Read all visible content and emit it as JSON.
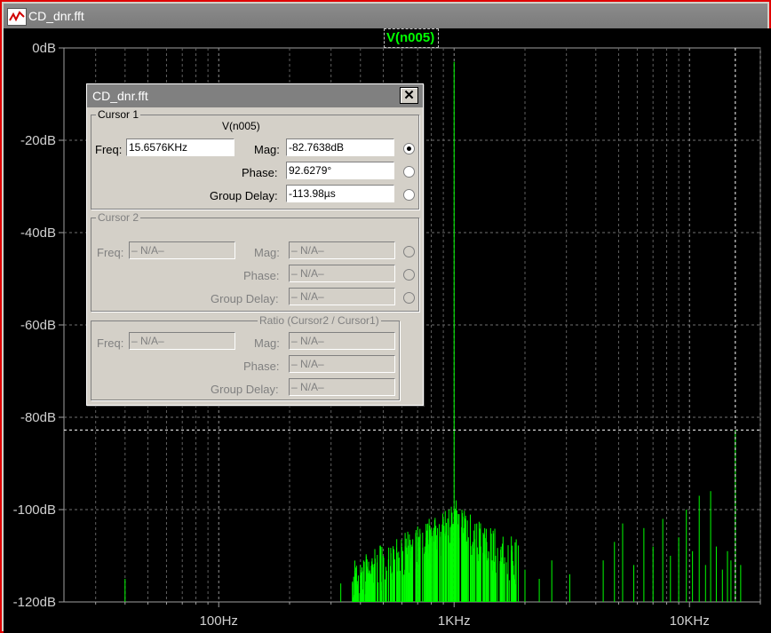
{
  "window": {
    "title": "CD_dnr.fft"
  },
  "trace": {
    "name": "V(n005)",
    "color": "#00ff00"
  },
  "chart_data": {
    "type": "line",
    "xscale": "log",
    "xlim": [
      22,
      20000
    ],
    "ylim": [
      -120,
      0
    ],
    "ylabel_ticks": [
      "0dB",
      "-20dB",
      "-40dB",
      "-60dB",
      "-80dB",
      "-100dB",
      "-120dB"
    ],
    "y_ticks": [
      0,
      -20,
      -40,
      -60,
      -80,
      -100,
      -120
    ],
    "xlabel_ticks": [
      "100Hz",
      "1KHz",
      "10KHz"
    ],
    "x_ticks": [
      100,
      1000,
      10000
    ],
    "cursor": {
      "freq_hz": 15657.6,
      "mag_db": -82.76
    },
    "series": [
      {
        "name": "V(n005)",
        "peaks": [
          {
            "f": 40,
            "db": -115
          },
          {
            "f": 330,
            "db": -116
          },
          {
            "f": 400,
            "db": -112
          },
          {
            "f": 450,
            "db": -113
          },
          {
            "f": 500,
            "db": -110
          },
          {
            "f": 550,
            "db": -111
          },
          {
            "f": 600,
            "db": -108
          },
          {
            "f": 650,
            "db": -109
          },
          {
            "f": 700,
            "db": -107
          },
          {
            "f": 750,
            "db": -108
          },
          {
            "f": 800,
            "db": -105
          },
          {
            "f": 850,
            "db": -104
          },
          {
            "f": 900,
            "db": -102
          },
          {
            "f": 950,
            "db": -100
          },
          {
            "f": 1000,
            "db": -3
          },
          {
            "f": 1020,
            "db": -98
          },
          {
            "f": 1050,
            "db": -101
          },
          {
            "f": 1100,
            "db": -104
          },
          {
            "f": 1150,
            "db": -106
          },
          {
            "f": 1200,
            "db": -107
          },
          {
            "f": 1300,
            "db": -108
          },
          {
            "f": 1400,
            "db": -109
          },
          {
            "f": 1500,
            "db": -110
          },
          {
            "f": 1600,
            "db": -112
          },
          {
            "f": 1750,
            "db": -114
          },
          {
            "f": 2000,
            "db": -113
          },
          {
            "f": 2300,
            "db": -115
          },
          {
            "f": 2600,
            "db": -111
          },
          {
            "f": 3100,
            "db": -114
          },
          {
            "f": 4300,
            "db": -111
          },
          {
            "f": 4800,
            "db": -107
          },
          {
            "f": 5200,
            "db": -103
          },
          {
            "f": 5800,
            "db": -112
          },
          {
            "f": 6400,
            "db": -104
          },
          {
            "f": 7000,
            "db": -108
          },
          {
            "f": 7700,
            "db": -102
          },
          {
            "f": 8300,
            "db": -110
          },
          {
            "f": 9000,
            "db": -106
          },
          {
            "f": 9700,
            "db": -100
          },
          {
            "f": 10300,
            "db": -109
          },
          {
            "f": 11000,
            "db": -97
          },
          {
            "f": 11700,
            "db": -112
          },
          {
            "f": 12300,
            "db": -96
          },
          {
            "f": 13000,
            "db": -108
          },
          {
            "f": 13800,
            "db": -113
          },
          {
            "f": 14500,
            "db": -109
          },
          {
            "f": 15000,
            "db": -111
          },
          {
            "f": 15657,
            "db": -82.76
          },
          {
            "f": 16500,
            "db": -112
          }
        ]
      }
    ]
  },
  "dialog": {
    "title": "CD_dnr.fft",
    "close": "✕",
    "cursor1": {
      "legend": "Cursor 1",
      "trace": "V(n005)",
      "freq_label": "Freq:",
      "freq": "15.6576KHz",
      "mag_label": "Mag:",
      "mag": "-82.7638dB",
      "phase_label": "Phase:",
      "phase": "92.6279°",
      "gd_label": "Group Delay:",
      "gd": "-113.98µs"
    },
    "cursor2": {
      "legend": "Cursor 2",
      "freq_label": "Freq:",
      "freq": "– N/A–",
      "mag_label": "Mag:",
      "mag": "– N/A–",
      "phase_label": "Phase:",
      "phase": "– N/A–",
      "gd_label": "Group Delay:",
      "gd": "– N/A–"
    },
    "ratio": {
      "legend": "Ratio (Cursor2 / Cursor1)",
      "freq_label": "Freq:",
      "freq": "– N/A–",
      "mag_label": "Mag:",
      "mag": "– N/A–",
      "phase_label": "Phase:",
      "phase": "– N/A–",
      "gd_label": "Group Delay:",
      "gd": "– N/A–"
    }
  }
}
